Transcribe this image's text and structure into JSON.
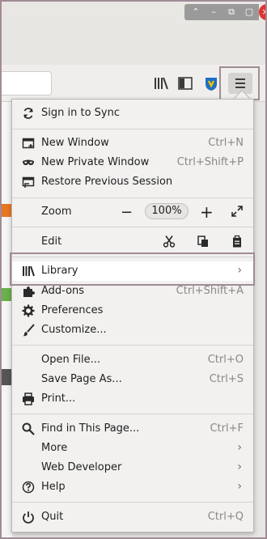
{
  "menu": {
    "sync_label": "Sign in to Sync",
    "new_window": {
      "label": "New Window",
      "shortcut": "Ctrl+N"
    },
    "new_private": {
      "label": "New Private Window",
      "shortcut": "Ctrl+Shift+P"
    },
    "restore": {
      "label": "Restore Previous Session"
    },
    "zoom": {
      "label": "Zoom",
      "minus": "−",
      "value": "100%",
      "plus": "+"
    },
    "edit": {
      "label": "Edit"
    },
    "library": {
      "label": "Library"
    },
    "addons": {
      "label": "Add-ons",
      "shortcut": "Ctrl+Shift+A"
    },
    "preferences": {
      "label": "Preferences"
    },
    "customize": {
      "label": "Customize..."
    },
    "open_file": {
      "label": "Open File...",
      "shortcut": "Ctrl+O"
    },
    "save_page": {
      "label": "Save Page As...",
      "shortcut": "Ctrl+S"
    },
    "print": {
      "label": "Print..."
    },
    "find": {
      "label": "Find in This Page...",
      "shortcut": "Ctrl+F"
    },
    "more": {
      "label": "More"
    },
    "web_dev": {
      "label": "Web Developer"
    },
    "help": {
      "label": "Help"
    },
    "quit": {
      "label": "Quit",
      "shortcut": "Ctrl+Q"
    }
  },
  "icons": {
    "sync": "sync-icon",
    "new_window": "window-icon",
    "private": "mask-icon",
    "restore": "restore-icon",
    "library": "library-icon",
    "addons": "puzzle-icon",
    "preferences": "gear-icon",
    "customize": "brush-icon",
    "print": "printer-icon",
    "find": "search-icon",
    "help": "help-icon",
    "quit": "power-icon"
  },
  "colors": {
    "accent_close": "#e0342f",
    "highlight_border": "#a08c96"
  }
}
